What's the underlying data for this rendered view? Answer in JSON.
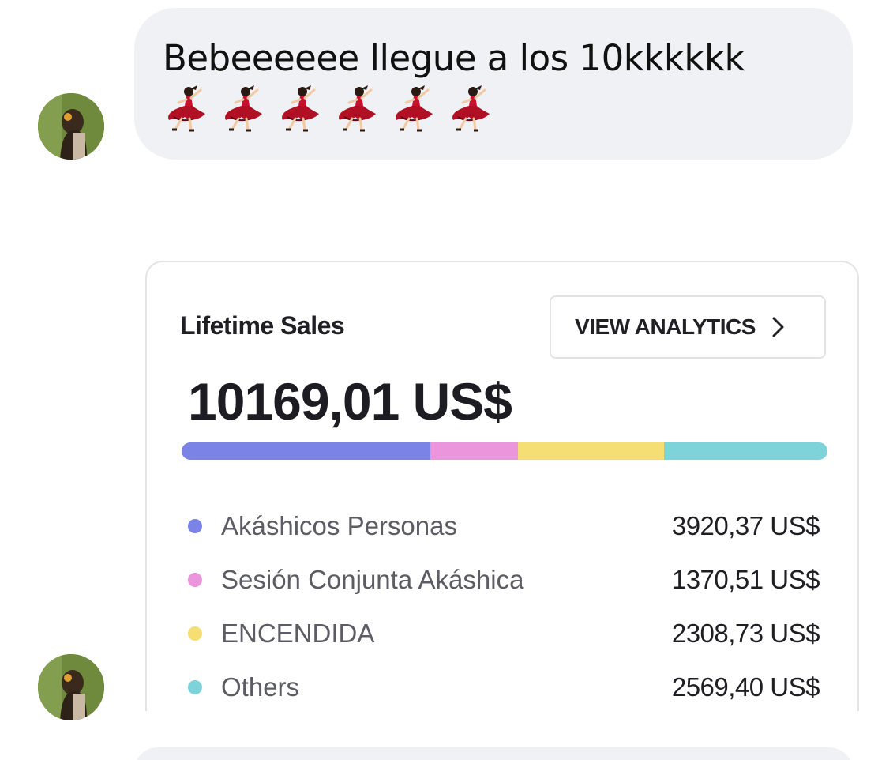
{
  "message": {
    "text": "Bebeeeeee llegue a los 10kkkkkk",
    "emoji_icon": "woman-dancing-emoji",
    "emoji_count": 6
  },
  "sales_card": {
    "title": "Lifetime Sales",
    "analytics_button": "VIEW ANALYTICS",
    "total": "10169,01 US$",
    "items": [
      {
        "label": "Akáshicos Personas",
        "value": "3920,37 US$",
        "color": "#7c83e6",
        "amount": 3920.37
      },
      {
        "label": "Sesión Conjunta Akáshica",
        "value": "1370,51 US$",
        "color": "#ea95dc",
        "amount": 1370.51
      },
      {
        "label": "ENCENDIDA",
        "value": "2308,73 US$",
        "color": "#f5df74",
        "amount": 2308.73
      },
      {
        "label": "Others",
        "value": "2569,40 US$",
        "color": "#7ed3da",
        "amount": 2569.4
      }
    ]
  }
}
